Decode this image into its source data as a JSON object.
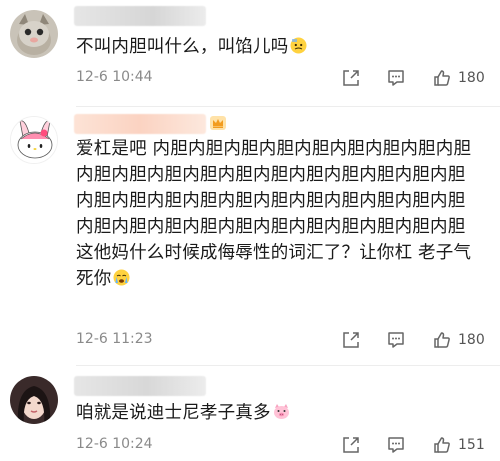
{
  "comments": [
    {
      "text": "不叫内胆叫什么，叫馅儿吗",
      "emoji": "cold-sweat-emoji",
      "timestamp": "12-6 10:44",
      "likes": "180"
    },
    {
      "line1": "爱杠是吧 内胆内胆内胆内胆内胆内胆内胆内胆内胆",
      "line2": "内胆内胆内胆内胆内胆内胆内胆内胆内胆内胆内胆",
      "line3": "内胆内胆内胆内胆内胆内胆内胆内胆内胆内胆内胆",
      "line4": "内胆内胆内胆内胆内胆内胆内胆内胆内胆内胆内胆",
      "line5": "这他妈什么时候成侮辱性的词汇了？让你杠 老子气",
      "line6": "死你",
      "emoji": "crying-emoji",
      "badge": "vip-crown-icon",
      "timestamp": "12-6 11:23",
      "likes": "180"
    },
    {
      "text": "咱就是说迪士尼孝子真多",
      "emoji": "pig-face-emoji",
      "timestamp": "12-6 10:24",
      "likes": "151"
    }
  ],
  "colors": {
    "text": "#1a1a1a",
    "meta": "#8a8a8a",
    "icon": "#666666",
    "divider": "#ededed"
  }
}
